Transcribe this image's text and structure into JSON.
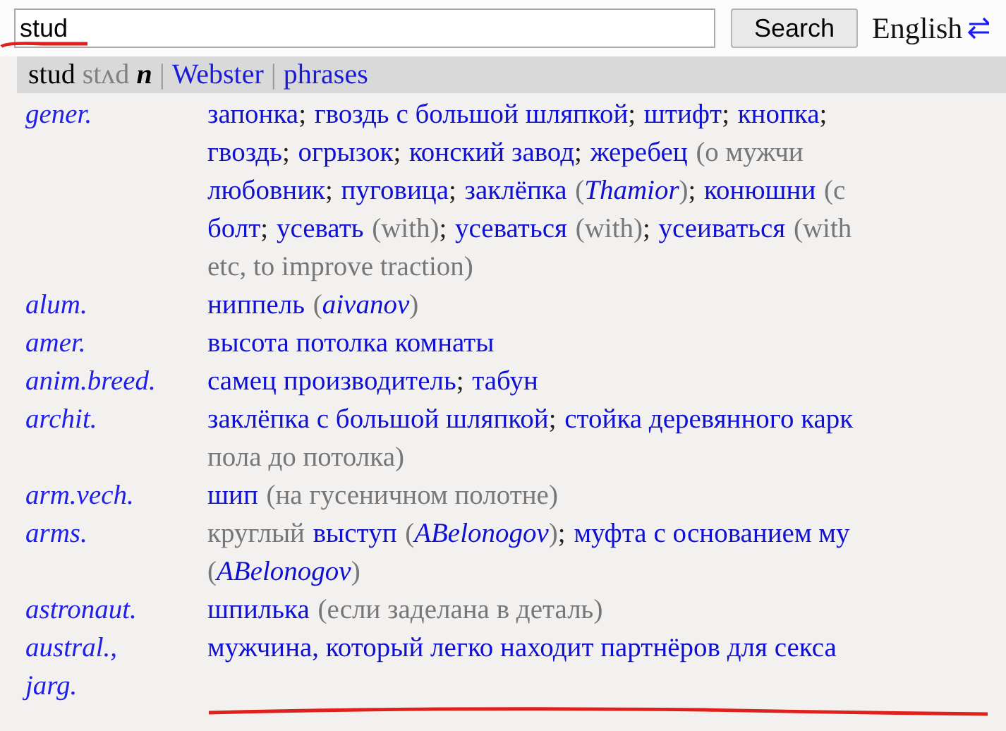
{
  "search": {
    "value": "stud",
    "button": "Search",
    "language": "English"
  },
  "header": {
    "word": "stud",
    "transcription": "stʌd",
    "pos": "n",
    "separator": "|",
    "links": [
      {
        "label": "Webster"
      },
      {
        "label": "phrases"
      }
    ]
  },
  "entries": [
    {
      "subject": "gener.",
      "lines": [
        [
          {
            "kind": "term",
            "text": "запонка"
          },
          {
            "kind": "sep",
            "text": ";"
          },
          {
            "kind": "term",
            "text": "гвоздь с большой шляпкой"
          },
          {
            "kind": "sep",
            "text": ";"
          },
          {
            "kind": "term",
            "text": "штифт"
          },
          {
            "kind": "sep",
            "text": ";"
          },
          {
            "kind": "term",
            "text": "кнопка"
          },
          {
            "kind": "sep",
            "text": ";"
          }
        ],
        [
          {
            "kind": "term",
            "text": "гвоздь"
          },
          {
            "kind": "sep",
            "text": ";"
          },
          {
            "kind": "term",
            "text": "огрызок"
          },
          {
            "kind": "sep",
            "text": ";"
          },
          {
            "kind": "term",
            "text": "конский завод"
          },
          {
            "kind": "sep",
            "text": ";"
          },
          {
            "kind": "term",
            "text": "жеребец"
          },
          {
            "kind": "note",
            "text": "(о мужчи"
          }
        ],
        [
          {
            "kind": "term",
            "text": "любовник"
          },
          {
            "kind": "sep",
            "text": ";"
          },
          {
            "kind": "term",
            "text": "пуговица"
          },
          {
            "kind": "sep",
            "text": ";"
          },
          {
            "kind": "term",
            "text": "заклёпка"
          },
          {
            "kind": "note",
            "text": "("
          },
          {
            "kind": "author",
            "text": "Thamior"
          },
          {
            "kind": "note",
            "text": ")"
          },
          {
            "kind": "sep",
            "text": ";"
          },
          {
            "kind": "term",
            "text": "конюшни"
          },
          {
            "kind": "note",
            "text": "(с"
          }
        ],
        [
          {
            "kind": "term",
            "text": "болт"
          },
          {
            "kind": "sep",
            "text": ";"
          },
          {
            "kind": "term",
            "text": "усевать"
          },
          {
            "kind": "note",
            "text": "(with)"
          },
          {
            "kind": "sep",
            "text": ";"
          },
          {
            "kind": "term",
            "text": "усеваться"
          },
          {
            "kind": "note",
            "text": "(with)"
          },
          {
            "kind": "sep",
            "text": ";"
          },
          {
            "kind": "term",
            "text": "усеиваться"
          },
          {
            "kind": "note",
            "text": "(with"
          }
        ],
        [
          {
            "kind": "note",
            "text": "etc, to improve traction)"
          }
        ]
      ]
    },
    {
      "subject": "alum.",
      "lines": [
        [
          {
            "kind": "term",
            "text": "ниппель"
          },
          {
            "kind": "note",
            "text": "("
          },
          {
            "kind": "author",
            "text": "aivanov"
          },
          {
            "kind": "note",
            "text": ")"
          }
        ]
      ]
    },
    {
      "subject": "amer.",
      "lines": [
        [
          {
            "kind": "term",
            "text": "высота потолка комнаты"
          }
        ]
      ]
    },
    {
      "subject": "anim.breed.",
      "lines": [
        [
          {
            "kind": "term",
            "text": "самец производитель"
          },
          {
            "kind": "sep",
            "text": ";"
          },
          {
            "kind": "term",
            "text": "табун"
          }
        ]
      ]
    },
    {
      "subject": "archit.",
      "lines": [
        [
          {
            "kind": "term",
            "text": "заклёпка с большой шляпкой"
          },
          {
            "kind": "sep",
            "text": ";"
          },
          {
            "kind": "term",
            "text": "стойка деревянного карк"
          }
        ],
        [
          {
            "kind": "note",
            "text": "пола до потолка)"
          }
        ]
      ]
    },
    {
      "subject": "arm.vech.",
      "lines": [
        [
          {
            "kind": "term",
            "text": "шип"
          },
          {
            "kind": "note",
            "text": "(на гусеничном полотне)"
          }
        ]
      ]
    },
    {
      "subject": "arms.",
      "lines": [
        [
          {
            "kind": "note",
            "text": "круглый"
          },
          {
            "kind": "term",
            "text": "выступ"
          },
          {
            "kind": "note",
            "text": "("
          },
          {
            "kind": "author",
            "text": "ABelonogov"
          },
          {
            "kind": "note",
            "text": ")"
          },
          {
            "kind": "sep",
            "text": ";"
          },
          {
            "kind": "term",
            "text": "муфта с основанием му"
          }
        ],
        [
          {
            "kind": "note",
            "text": "("
          },
          {
            "kind": "author",
            "text": "ABelonogov"
          },
          {
            "kind": "note",
            "text": ")"
          }
        ]
      ]
    },
    {
      "subject": "astronaut.",
      "lines": [
        [
          {
            "kind": "term",
            "text": "шпилька"
          },
          {
            "kind": "note",
            "text": "(если заделана в деталь)"
          }
        ]
      ]
    },
    {
      "subject": "austral., jarg.",
      "lines": [
        [
          {
            "kind": "term",
            "text": "мужчина, который легко находит партнёров для секса"
          }
        ]
      ]
    }
  ]
}
